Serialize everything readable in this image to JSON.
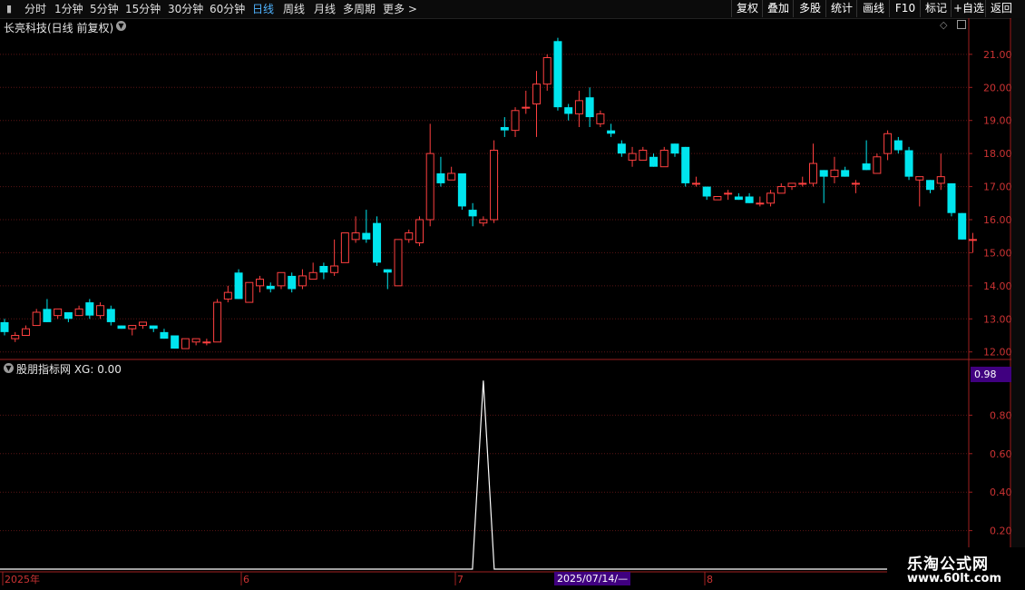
{
  "toolbar": {
    "periods": [
      "分时",
      "1分钟",
      "5分钟",
      "15分钟",
      "30分钟",
      "60分钟",
      "日线",
      "周线",
      "月线",
      "多周期",
      "更多 >"
    ],
    "active_period": "日线",
    "tools": [
      "复权",
      "叠加",
      "多股",
      "统计",
      "画线",
      "F10",
      "标记",
      "+自选",
      "返回"
    ]
  },
  "kline": {
    "title": "长亮科技(日线 前复权)",
    "y_labels": [
      "21.00",
      "20.00",
      "19.00",
      "18.00",
      "17.00",
      "16.00",
      "15.00",
      "14.00",
      "13.00",
      "12.00"
    ],
    "y_range": [
      11.8,
      21.6
    ]
  },
  "indicator": {
    "title": "股朋指标网 XG: 0.00",
    "value_badge": "0.98",
    "y_labels": [
      "0.80",
      "0.60",
      "0.40",
      "0.20"
    ]
  },
  "date_axis": {
    "labels": [
      "2025年",
      "6",
      "7",
      "8"
    ],
    "cursor_date": "2025/07/14/—"
  },
  "watermark": {
    "line1": "乐淘公式网",
    "line2": "www.60lt.com"
  },
  "colors": {
    "up": "#ff4040",
    "down": "#00e5ee",
    "grid": "#5a1414",
    "frame": "#a02020"
  },
  "chart_data": {
    "type": "candlestick",
    "candles": [
      [
        12.9,
        12.6,
        13.0,
        12.5
      ],
      [
        12.4,
        12.5,
        12.6,
        12.3
      ],
      [
        12.5,
        12.7,
        12.8,
        12.5
      ],
      [
        12.8,
        13.2,
        13.3,
        12.8
      ],
      [
        13.3,
        12.9,
        13.6,
        12.9
      ],
      [
        13.1,
        13.3,
        13.3,
        13.0
      ],
      [
        13.2,
        13.0,
        13.2,
        12.9
      ],
      [
        13.1,
        13.3,
        13.4,
        13.1
      ],
      [
        13.5,
        13.1,
        13.6,
        13.0
      ],
      [
        13.1,
        13.4,
        13.5,
        13.0
      ],
      [
        13.3,
        12.9,
        13.4,
        12.8
      ],
      [
        12.8,
        12.7,
        12.8,
        12.7
      ],
      [
        12.7,
        12.8,
        12.8,
        12.5
      ],
      [
        12.8,
        12.9,
        12.9,
        12.7
      ],
      [
        12.8,
        12.7,
        12.8,
        12.6
      ],
      [
        12.6,
        12.4,
        12.7,
        12.4
      ],
      [
        12.5,
        12.1,
        12.5,
        12.1
      ],
      [
        12.1,
        12.4,
        12.4,
        12.1
      ],
      [
        12.3,
        12.4,
        12.4,
        12.2
      ],
      [
        12.3,
        12.3,
        12.4,
        12.2
      ],
      [
        12.3,
        13.5,
        13.6,
        12.3
      ],
      [
        13.6,
        13.8,
        14.0,
        13.5
      ],
      [
        14.4,
        13.6,
        14.5,
        13.6
      ],
      [
        13.5,
        14.1,
        14.1,
        13.5
      ],
      [
        14.0,
        14.2,
        14.3,
        13.8
      ],
      [
        14.0,
        13.9,
        14.1,
        13.8
      ],
      [
        14.0,
        14.4,
        14.4,
        13.9
      ],
      [
        14.3,
        13.9,
        14.4,
        13.8
      ],
      [
        14.0,
        14.3,
        14.5,
        13.9
      ],
      [
        14.2,
        14.4,
        14.7,
        14.2
      ],
      [
        14.6,
        14.4,
        14.7,
        14.2
      ],
      [
        14.4,
        14.6,
        15.4,
        14.3
      ],
      [
        14.7,
        15.6,
        15.6,
        14.7
      ],
      [
        15.4,
        15.6,
        16.1,
        15.3
      ],
      [
        15.6,
        15.4,
        16.3,
        15.3
      ],
      [
        15.9,
        14.7,
        16.1,
        14.6
      ],
      [
        14.5,
        14.4,
        14.5,
        13.9
      ],
      [
        14.0,
        15.4,
        15.4,
        14.0
      ],
      [
        15.4,
        15.6,
        15.7,
        15.3
      ],
      [
        15.3,
        16.0,
        16.1,
        15.2
      ],
      [
        16.0,
        18.0,
        18.9,
        15.8
      ],
      [
        17.4,
        17.1,
        17.9,
        17.0
      ],
      [
        17.2,
        17.4,
        17.6,
        17.2
      ],
      [
        17.4,
        16.4,
        17.4,
        16.3
      ],
      [
        16.3,
        16.1,
        16.5,
        15.8
      ],
      [
        15.9,
        16.0,
        16.1,
        15.8
      ],
      [
        16.0,
        18.1,
        18.4,
        15.9
      ],
      [
        18.8,
        18.7,
        19.1,
        18.5
      ],
      [
        18.7,
        19.3,
        19.4,
        18.5
      ],
      [
        19.4,
        19.4,
        19.9,
        19.2
      ],
      [
        19.5,
        20.1,
        20.5,
        18.5
      ],
      [
        20.1,
        20.9,
        21.0,
        19.9
      ],
      [
        21.4,
        19.4,
        21.5,
        19.3
      ],
      [
        19.4,
        19.2,
        19.5,
        19.0
      ],
      [
        19.2,
        19.6,
        19.9,
        18.8
      ],
      [
        19.7,
        19.1,
        20.0,
        18.8
      ],
      [
        18.9,
        19.2,
        19.3,
        18.8
      ],
      [
        18.7,
        18.6,
        18.9,
        18.5
      ],
      [
        18.3,
        18.0,
        18.4,
        17.9
      ],
      [
        17.8,
        18.0,
        18.2,
        17.6
      ],
      [
        17.8,
        18.1,
        18.2,
        17.8
      ],
      [
        17.9,
        17.6,
        18.0,
        17.6
      ],
      [
        17.6,
        18.1,
        18.2,
        17.6
      ],
      [
        18.3,
        18.0,
        18.3,
        17.9
      ],
      [
        18.2,
        17.1,
        18.2,
        17.0
      ],
      [
        17.1,
        17.1,
        17.3,
        17.0
      ],
      [
        17.0,
        16.7,
        17.0,
        16.6
      ],
      [
        16.6,
        16.7,
        16.7,
        16.6
      ],
      [
        16.8,
        16.8,
        16.9,
        16.6
      ],
      [
        16.7,
        16.6,
        16.8,
        16.6
      ],
      [
        16.7,
        16.5,
        16.8,
        16.5
      ],
      [
        16.5,
        16.5,
        16.7,
        16.4
      ],
      [
        16.5,
        16.8,
        16.9,
        16.4
      ],
      [
        16.8,
        17.0,
        17.1,
        16.8
      ],
      [
        17.0,
        17.1,
        17.1,
        16.9
      ],
      [
        17.1,
        17.1,
        17.3,
        17.0
      ],
      [
        17.1,
        17.7,
        18.3,
        17.0
      ],
      [
        17.5,
        17.3,
        17.5,
        16.5
      ],
      [
        17.3,
        17.5,
        17.9,
        17.1
      ],
      [
        17.5,
        17.3,
        17.6,
        17.3
      ],
      [
        17.1,
        17.1,
        17.2,
        16.8
      ],
      [
        17.7,
        17.5,
        18.4,
        17.5
      ],
      [
        17.4,
        17.9,
        18.0,
        17.4
      ],
      [
        18.0,
        18.6,
        18.7,
        17.8
      ],
      [
        18.4,
        18.1,
        18.5,
        18.0
      ],
      [
        18.1,
        17.3,
        18.2,
        17.2
      ],
      [
        17.2,
        17.3,
        17.3,
        16.4
      ],
      [
        17.2,
        16.9,
        17.2,
        16.8
      ],
      [
        17.1,
        17.3,
        18.0,
        16.9
      ],
      [
        17.1,
        16.2,
        17.1,
        16.1
      ],
      [
        16.2,
        15.4,
        16.2,
        15.4
      ],
      [
        15.4,
        15.4,
        15.6,
        15.0
      ]
    ],
    "indicator_series": {
      "name": "XG",
      "peak_index": 45,
      "peak_value": 0.98,
      "baseline": 0.0,
      "y_range": [
        0,
        1.0
      ]
    }
  }
}
